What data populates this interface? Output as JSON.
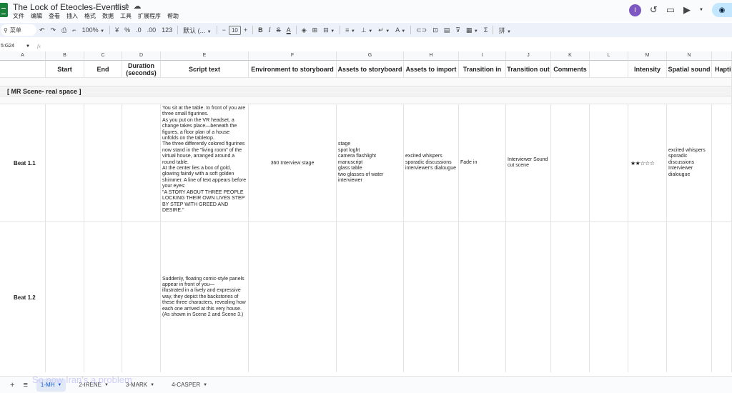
{
  "window": {
    "title": "The Lock of Eteocles-Eventlist",
    "menu": [
      "文件",
      "编辑",
      "查看",
      "插入",
      "格式",
      "数据",
      "工具",
      "扩展程序",
      "帮助"
    ],
    "avatar_letter": "I",
    "accent": "#0b57d0",
    "brand": "#188038"
  },
  "toolbar": {
    "search_label": "菜单",
    "zoom": "100%",
    "currency": "¥",
    "percent": "%",
    "dec_decrease": ".0",
    "dec_increase": ".00",
    "num_format": "123",
    "font": "默认 (...",
    "font_size": "10",
    "bold": "B",
    "italic": "I",
    "strike": "S",
    "text_color": "A"
  },
  "formula_bar": {
    "name_box": "5:G24",
    "fx": "fx"
  },
  "columns": [
    "A",
    "B",
    "C",
    "D",
    "E",
    "F",
    "G",
    "H",
    "I",
    "J",
    "K",
    "L",
    "M",
    "N",
    ""
  ],
  "header_row": {
    "start": "Start",
    "end": "End",
    "duration": "Duration (seconds)",
    "script": "Script text",
    "env": "Environment to storyboard",
    "assets_story": "Assets to storyboard",
    "assets_import": "Assets to import",
    "trans_in": "Transition in",
    "trans_out": "Transition out",
    "comments": "Comments",
    "intensity": "Intensity",
    "spatial": "Spatial sound",
    "haptic": "Haptic"
  },
  "section_title": "[ MR Scene- real space ]",
  "beats": [
    {
      "label": "Beat 1.1",
      "script": "You sit at the table. In front of you are three small figurines.\nAs you put on the VR headset, a change takes place—beneath the figures, a floor plan of a house unfolds on the tabletop.\nThe three differently colored figurines now stand in the \"living room\" of the virtual house, arranged around a round table.\nAt the center lies a box of gold, glowing faintly with a soft golden shimmer. A line of text appears before your eyes:\n\"A STORY ABOUT THREE PEOPLE LOCKING THEIR OWN LIVES STEP BY STEP WITH GREED AND DESIRE.\"",
      "env": "360 Interview stage",
      "assets_story": "stage\nspot loght\ncamera flashlight\nmanuscript\nglass table\ntwo glasses of water\ninterviewer",
      "assets_import": "excited whispers\nsporadic discussions\ninterviewer's dialougue",
      "trans_in": "Fade in",
      "trans_out": "Interviewer Sound\ncut scene",
      "intensity": "★★☆☆☆",
      "spatial": "excited whispers\nsporadic discussions\nInterviewer dialougue"
    },
    {
      "label": "Beat 1.2",
      "script": "Suddenly, floating comic-style panels appear in front of you—\nillustrated in a lively and expressive way, they depict the backstories of these three characters, revealing how each one arrived at this very house.(As shown in Scene 2 and Scene 3.)"
    }
  ],
  "sheets": [
    "1-MH",
    "2-IRENE",
    "3-MARK",
    "4-CASPER"
  ],
  "overlay_text": "So now Iran's a problem"
}
